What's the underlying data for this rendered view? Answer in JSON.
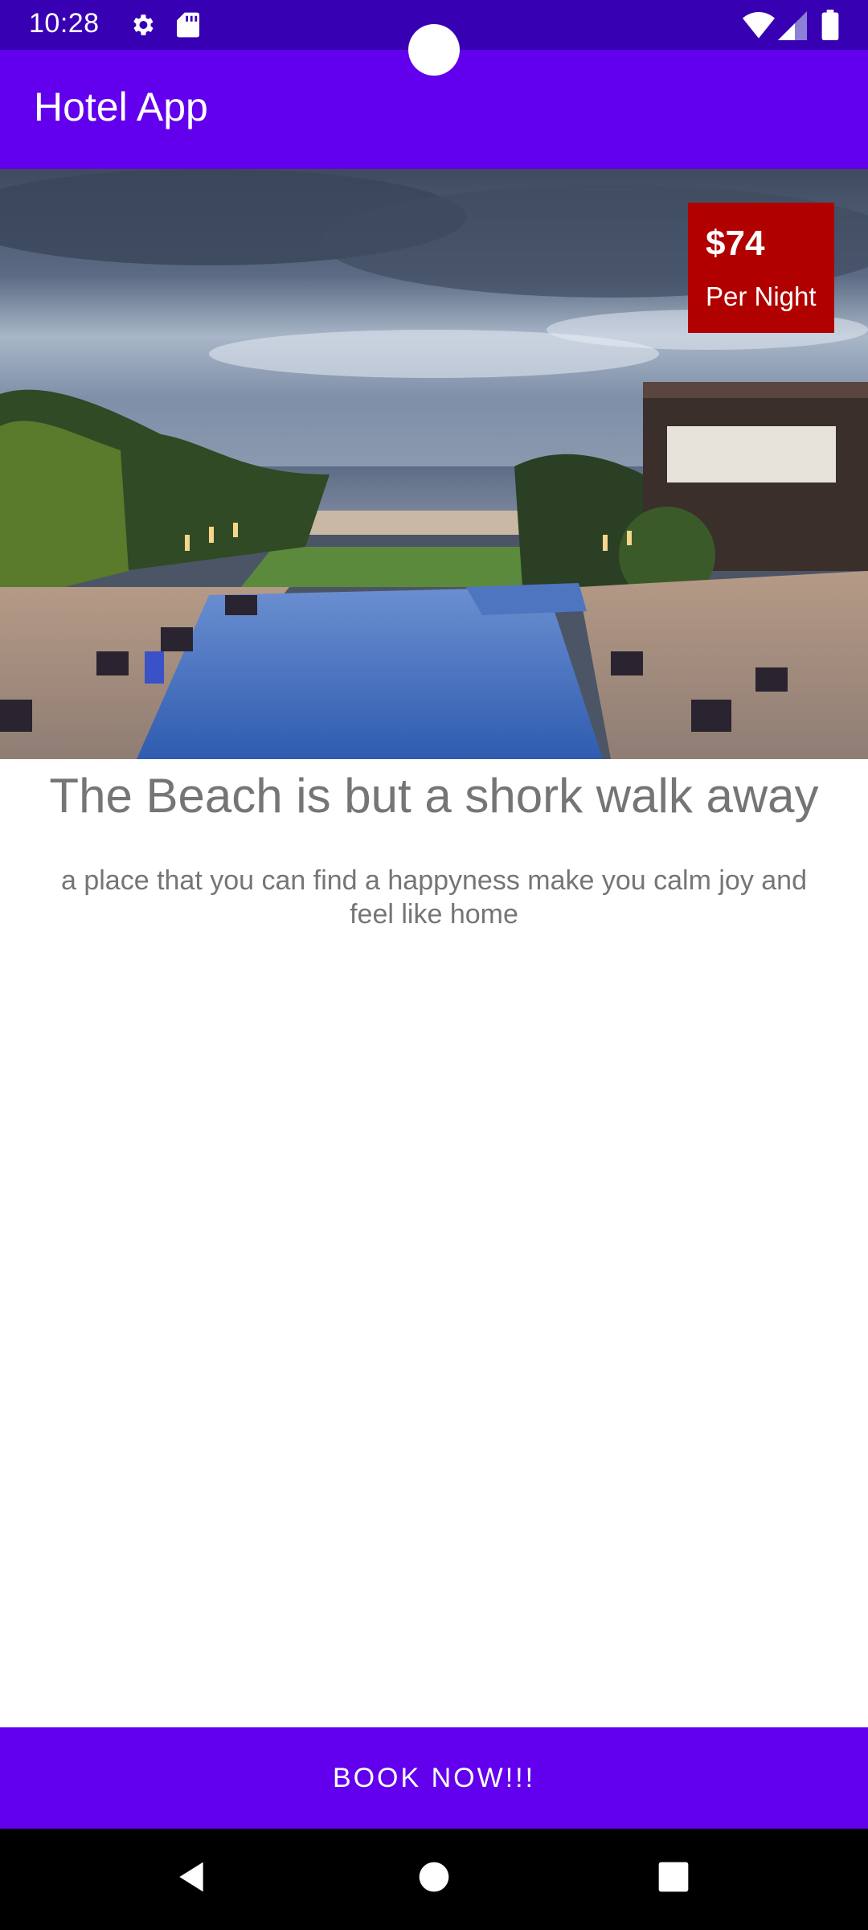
{
  "status_bar": {
    "time": "10:28",
    "icons": [
      "gear-icon",
      "sd-card-icon",
      "wifi-icon",
      "signal-icon",
      "battery-icon"
    ]
  },
  "app_bar": {
    "title": "Hotel App"
  },
  "hero": {
    "image": "beach-resort-pool-photo",
    "price": {
      "amount": "$74",
      "unit": "Per Night"
    }
  },
  "content": {
    "headline": "The Beach is but a shork walk away",
    "description": "a place that you can find a happyness make you calm joy and feel like home"
  },
  "actions": {
    "book_label": "BOOK NOW!!!"
  },
  "nav_bar": {
    "icons": [
      "back-icon",
      "home-icon",
      "recent-apps-icon"
    ]
  },
  "colors": {
    "status_bar": "#3700b3",
    "primary": "#6200ee",
    "price_badge": "#b00000",
    "text_secondary": "#757575"
  }
}
